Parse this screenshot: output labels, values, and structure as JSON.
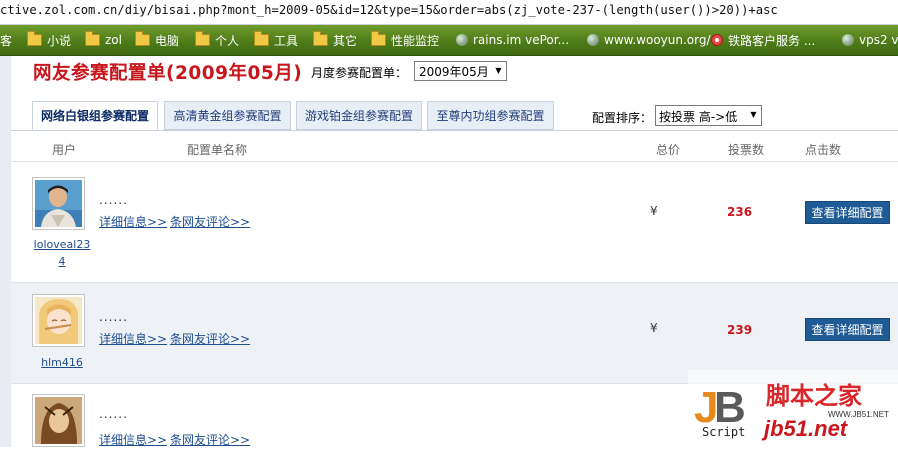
{
  "browser": {
    "url": "ctive.zol.com.cn/diy/bisai.php?mont_h=2009-05&id=12&type=15&order=abs(zj_vote-237-(length(user())>20))+asc",
    "bookmarks": [
      {
        "label": "客",
        "icon": "folder-icon"
      },
      {
        "label": "小说",
        "icon": "folder-icon"
      },
      {
        "label": "zol",
        "icon": "folder-icon"
      },
      {
        "label": "电脑",
        "icon": "folder-icon"
      },
      {
        "label": "个人",
        "icon": "folder-icon"
      },
      {
        "label": "工具",
        "icon": "folder-icon"
      },
      {
        "label": "其它",
        "icon": "folder-icon"
      },
      {
        "label": "性能监控",
        "icon": "folder-icon"
      },
      {
        "label": "rains.im vePor...",
        "icon": "globe-icon"
      },
      {
        "label": "www.wooyun.org/",
        "icon": "globe-icon"
      },
      {
        "label": "铁路客户服务 ...",
        "icon": "railway-icon"
      },
      {
        "label": "vps2 v",
        "icon": "globe-icon"
      }
    ]
  },
  "page": {
    "title": "网友参赛配置单(2009年05月)",
    "month_label": "月度参赛配置单：",
    "month_value": "2009年05月",
    "tabs": [
      {
        "label": "网络白银组参赛配置",
        "active": true
      },
      {
        "label": "高清黄金组参赛配置",
        "active": false
      },
      {
        "label": "游戏铂金组参赛配置",
        "active": false
      },
      {
        "label": "至尊内功组参赛配置",
        "active": false
      }
    ],
    "sort_label": "配置排序：",
    "sort_value": "按投票 高->低",
    "columns": {
      "user": "用户",
      "config_name": "配置单名称",
      "total_price": "总价",
      "votes": "投票数",
      "clicks": "点击数"
    },
    "rows": [
      {
        "username": "loloveal234",
        "name_text": "......",
        "detail_link": "详细信息>>",
        "comments_link": "条网友评论>>",
        "price": "¥",
        "votes": "236",
        "button": "查看详细配置"
      },
      {
        "username": "hlm416",
        "name_text": "......",
        "detail_link": "详细信息>>",
        "comments_link": "条网友评论>>",
        "price": "¥",
        "votes": "239",
        "button": "查看详细配置"
      },
      {
        "username": "",
        "name_text": "......",
        "detail_link": "详细信息>>",
        "comments_link": "条网友评论>>",
        "price": "",
        "votes": "",
        "button": ""
      }
    ],
    "watermark": {
      "logo": "JB",
      "script": "Script",
      "title": "脚本之家",
      "domain": "jb51.net",
      "url": "WWW.JB51.NET"
    }
  },
  "colors": {
    "title_red": "#c8161d",
    "bookmark_green": "#4c7a17",
    "button_blue": "#1f5b94",
    "link_blue": "#1d4d8f"
  }
}
